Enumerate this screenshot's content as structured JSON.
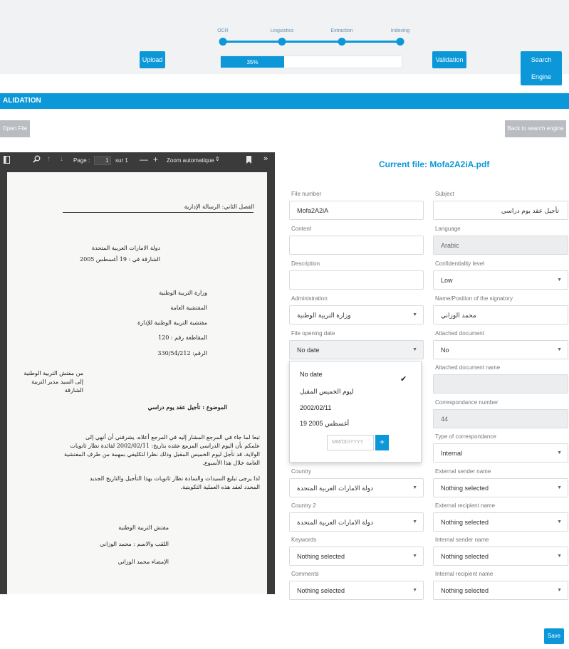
{
  "pipeline": {
    "upload_label": "Upload",
    "validation_label": "Validation",
    "search_engine_label": "Search Engine",
    "steps": [
      "OCR",
      "Linguistics",
      "Extraction",
      "Indexing"
    ],
    "progress_text": "35%",
    "progress_value": 35
  },
  "validation": {
    "header": "ALIDATION",
    "open_file_label": "Open File",
    "back_label": "Back to search engine"
  },
  "pdf_viewer": {
    "page_label": "Page :",
    "page_number": "1",
    "page_of": "sur 1",
    "zoom_label": "Zoom automatique",
    "document_lines": [
      "الفصل الثاني: الرسالة الإدارية",
      "دولة الامارات العربية المتحدة",
      "الشارقة في : 19 أغسطس 2005",
      "وزارة التربية الوطنية",
      "المفتشية العامة",
      "مفتشية التربية الوطنية للإدارة",
      "المقاطعة رقم : 120",
      "الرقم: 330/54/212",
      "من مفتش التربية الوطنية",
      "إلى السيد مدير التربية",
      "الشارقة",
      "الموضوع : تأجيل عقد يوم دراسي",
      "تبعا لما جاء في المرجع المشار إليه في المرجع أعلاه، يشرفني أن أنهي إلى",
      "علمكم بأن اليوم الدراسي المزمع عقده بتاريخ: 2002/02/11 لفائدة نظار ثانويات",
      "الولاية، قد تأجل ليوم الخميس المقبل وذلك نظرا لتكليفي بمهمة من طرف المفتشية",
      "العامة خلال هذا الأسبوع.",
      "لذا يرجى تبليغ السيدات والسادة نظار ثانويات بهذا التأجيل والتاريخ الجديد",
      "المحدد لعقد هذه العملية التكوينية.",
      "مفتش التربية الوطنية",
      "اللقب والاسم : محمد الوزاني",
      "الإمضاء  محمد الوزاني"
    ]
  },
  "form": {
    "current_file": "Current file: Mofa2A2iA.pdf",
    "file_number": {
      "label": "File number",
      "value": "Mofa2A2iA"
    },
    "subject": {
      "label": "Subject",
      "value": "تأجيل عقد يوم دراسي"
    },
    "content": {
      "label": "Content",
      "value": ""
    },
    "language": {
      "label": "Language",
      "value": "Arabic"
    },
    "description": {
      "label": "Description",
      "value": ""
    },
    "confidentiality": {
      "label": "Confidentiality level",
      "value": "Low"
    },
    "administration": {
      "label": "Administration",
      "value": "وزارة التربية الوطنية"
    },
    "signatory": {
      "label": "Name/Position of the signatory",
      "value": "محمد الوزاني"
    },
    "opening_date": {
      "label": "File opening date",
      "value": "No date"
    },
    "attached_document": {
      "label": "Attached document",
      "value": "No"
    },
    "attached_document_name": {
      "label": "Attached document name",
      "value": ""
    },
    "correspondance_number": {
      "label": "Correspondance number",
      "value": "44"
    },
    "correspondance_type": {
      "label": "Type of correspondance",
      "value": "Internal"
    },
    "country": {
      "label": "Country",
      "value": "دولة الامارات العربية المتحدة"
    },
    "external_sender": {
      "label": "External sender name",
      "value": "Nothing selected"
    },
    "country2": {
      "label": "Country 2",
      "value": "دولة الامارات العربية المتحدة"
    },
    "external_recipient": {
      "label": "External recipient name",
      "value": "Nothing selected"
    },
    "keywords": {
      "label": "Keywords",
      "value": "Nothing selected"
    },
    "internal_sender": {
      "label": "Internal sender name",
      "value": "Nothing selected"
    },
    "comments": {
      "label": "Comments",
      "value": "Nothing selected"
    },
    "internal_recipient": {
      "label": "Internal recipient name",
      "value": "Nothing selected"
    }
  },
  "date_dropdown": {
    "options": [
      "No date",
      "ليوم الخميس المقبل",
      "2002/02/11",
      "أغسطس 2005 19"
    ],
    "date_placeholder": "MM/DD/YYYY",
    "add_label": "+"
  },
  "save_label": "Save",
  "colors": {
    "accent": "#0b97d8",
    "topbar_bg": "#f1f2f4",
    "viewer_bg": "#3b3b3b"
  },
  "icons": [
    "sidebar-toggle-icon",
    "search-icon",
    "arrow-up-icon",
    "arrow-down-icon",
    "zoom-out-icon",
    "zoom-in-icon",
    "bookmark-icon",
    "double-chevron-right-icon",
    "caret-down-icon",
    "checkmark-icon",
    "plus-icon"
  ]
}
